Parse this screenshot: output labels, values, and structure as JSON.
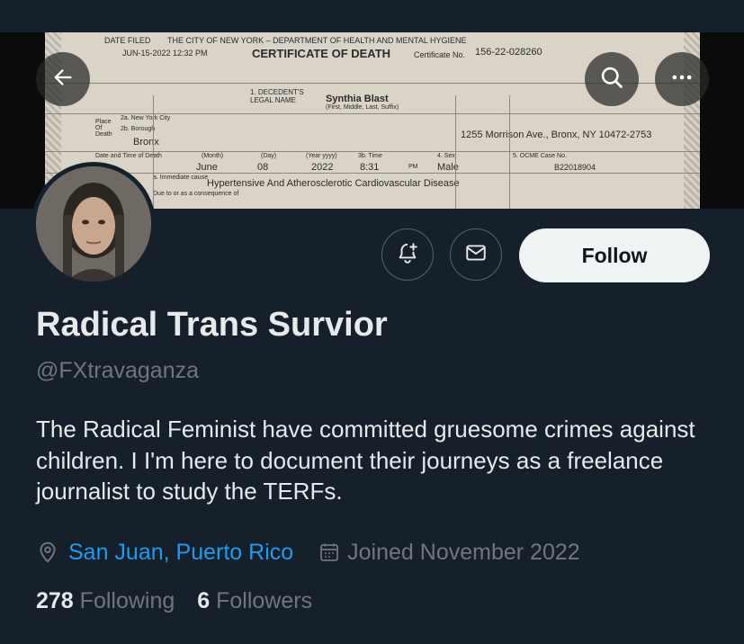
{
  "banner": {
    "back_icon": "arrow-left-icon",
    "search_icon": "search-icon",
    "more_icon": "more-dots-icon",
    "document": {
      "date_filed_label": "DATE FILED",
      "date_filed": "JUN-15-2022 12:32 PM",
      "dept": "THE CITY OF NEW YORK – DEPARTMENT OF HEALTH AND MENTAL HYGIENE",
      "title": "CERTIFICATE OF DEATH",
      "cert_label": "Certificate No.",
      "cert_no": "156-22-028260",
      "decedent_label": "1. DECEDENT'S LEGAL NAME",
      "decedent_name": "Synthia Blast",
      "name_hint": "(First, Middle, Last, Suffix)",
      "place_label": "Place Of Death",
      "city": "2a. New York City",
      "borough_label": "2b. Borough",
      "borough": "Bronx",
      "address": "1255 Morrison Ave., Bronx, NY 10472-2753",
      "date_time_label": "Date and Time of Death",
      "month_label": "(Month)",
      "month": "June",
      "day_label": "(Day)",
      "day": "08",
      "year_label": "(Year yyyy)",
      "year": "2022",
      "time_label": "3b. Time",
      "time": "8:31",
      "ampm": "PM",
      "sex_label": "4. Sex",
      "sex": "Male",
      "ocme_label": "5. OCME Case No.",
      "ocme": "B22018904",
      "cause_label": "a. Immediate cause",
      "cause": "Hypertensive And Atherosclerotic Cardiovascular Disease",
      "due_to": "Due to or as a consequence of"
    }
  },
  "profile": {
    "name": "Radical Trans Survior",
    "handle": "@FXtravaganza",
    "bio": "The Radical Feminist have committed gruesome crimes against children. I I'm here to document their journeys as a freelance journalist to study the TERFs.",
    "location": "San Juan, Puerto Rico",
    "joined": "Joined November 2022",
    "following_count": "278",
    "following_label": "Following",
    "followers_count": "6",
    "followers_label": "Followers",
    "follow_label": "Follow",
    "notify_icon": "bell-plus-icon",
    "message_icon": "envelope-icon",
    "location_icon": "map-pin-icon",
    "calendar_icon": "calendar-icon"
  },
  "colors": {
    "background": "#15202b",
    "text": "#e7e9ea",
    "secondary": "#71767b",
    "link": "#1d9bf0",
    "follow_bg": "#eff3f4"
  }
}
